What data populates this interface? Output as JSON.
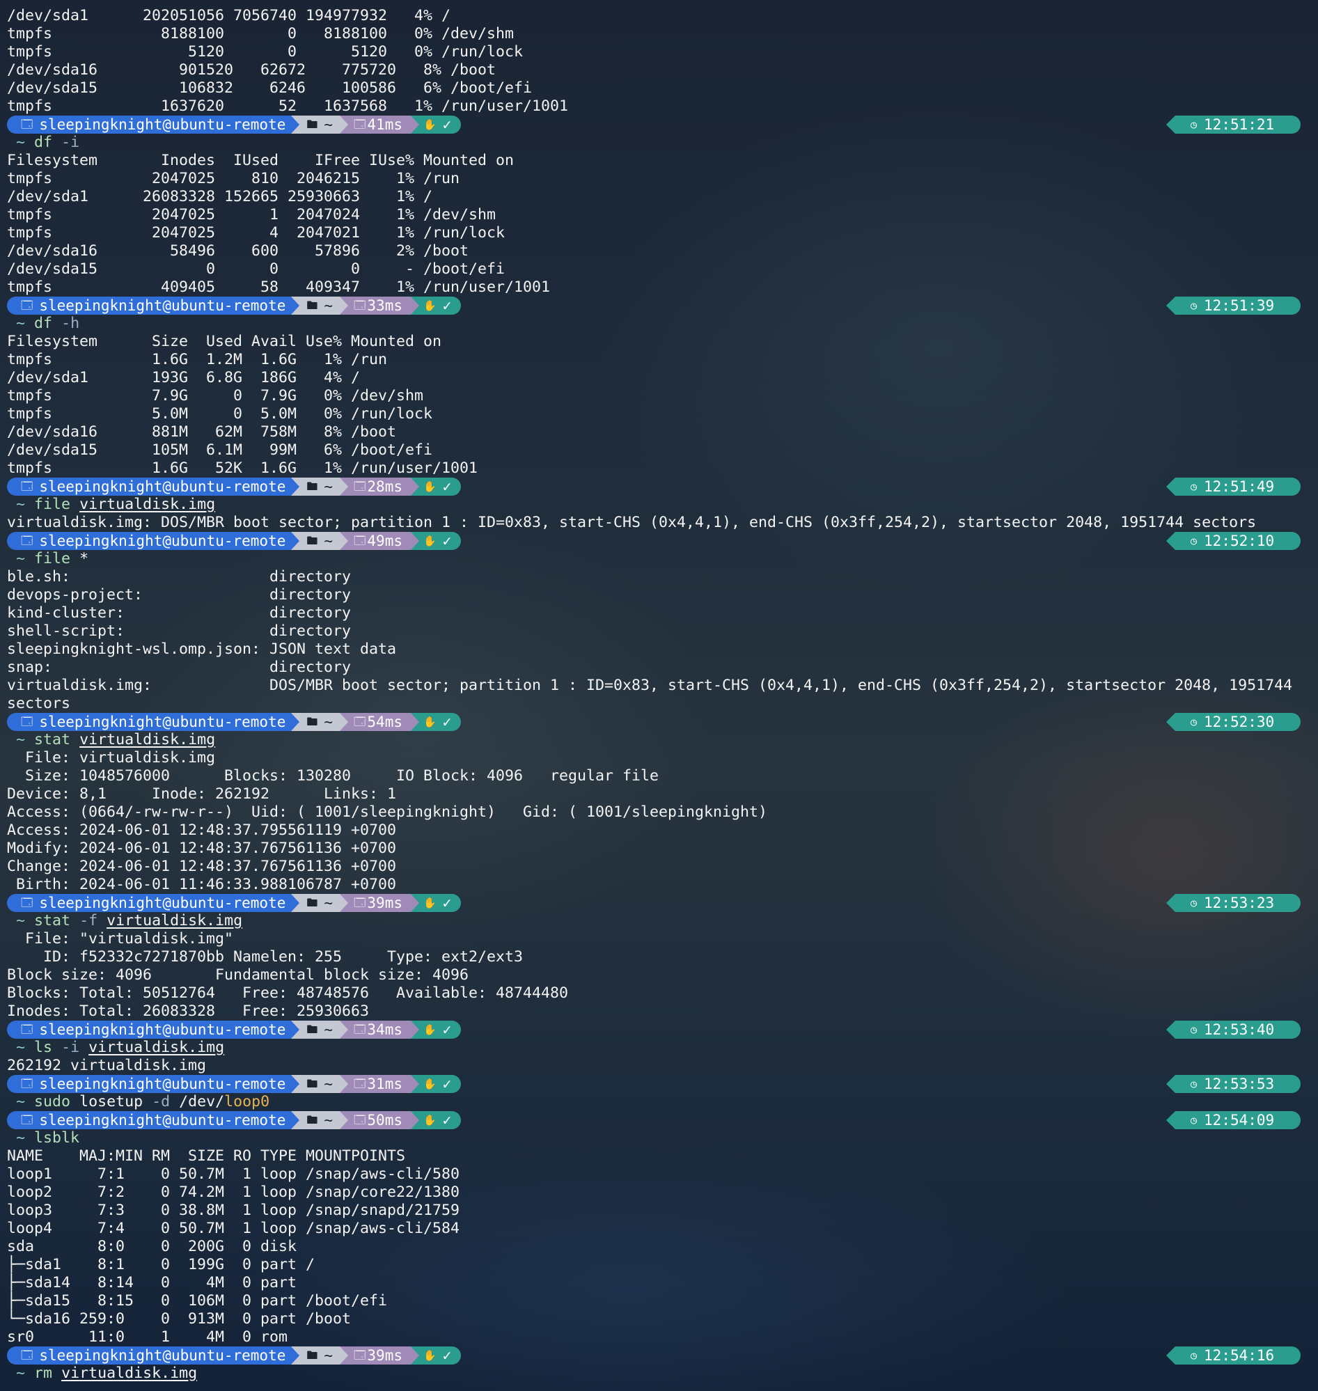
{
  "prompt": {
    "user_host": "sleepingknight@ubuntu-remote",
    "path_icon": "folder-icon",
    "path": "~",
    "status_icons": [
      "hand-icon",
      "check-icon"
    ],
    "check": "✓",
    "cwd_marker": "~",
    "clock_icon": "clock-icon"
  },
  "lines": [
    {
      "t": "out",
      "text": "/dev/sda1      202051056 7056740 194977932   4% /"
    },
    {
      "t": "out",
      "text": "tmpfs            8188100       0   8188100   0% /dev/shm"
    },
    {
      "t": "out",
      "text": "tmpfs               5120       0      5120   0% /run/lock"
    },
    {
      "t": "out",
      "text": "/dev/sda16         901520   62672    775720   8% /boot"
    },
    {
      "t": "out",
      "text": "/dev/sda15         106832    6246    100586   6% /boot/efi"
    },
    {
      "t": "out",
      "text": "tmpfs            1637620      52   1637568   1% /run/user/1001"
    },
    {
      "t": "prompt",
      "duration": "41ms",
      "clock": "12:51:21"
    },
    {
      "t": "cmd",
      "parts": [
        {
          "k": "name",
          "v": "df"
        },
        {
          "k": "sp",
          "v": " "
        },
        {
          "k": "flag",
          "v": "-i"
        }
      ]
    },
    {
      "t": "out",
      "text": "Filesystem       Inodes  IUsed    IFree IUse% Mounted on"
    },
    {
      "t": "out",
      "text": "tmpfs           2047025    810  2046215    1% /run"
    },
    {
      "t": "out",
      "text": "/dev/sda1      26083328 152665 25930663    1% /"
    },
    {
      "t": "out",
      "text": "tmpfs           2047025      1  2047024    1% /dev/shm"
    },
    {
      "t": "out",
      "text": "tmpfs           2047025      4  2047021    1% /run/lock"
    },
    {
      "t": "out",
      "text": "/dev/sda16        58496    600    57896    2% /boot"
    },
    {
      "t": "out",
      "text": "/dev/sda15            0      0        0     - /boot/efi"
    },
    {
      "t": "out",
      "text": "tmpfs            409405     58   409347    1% /run/user/1001"
    },
    {
      "t": "prompt",
      "duration": "33ms",
      "clock": "12:51:39"
    },
    {
      "t": "cmd",
      "parts": [
        {
          "k": "name",
          "v": "df"
        },
        {
          "k": "sp",
          "v": " "
        },
        {
          "k": "flag",
          "v": "-h"
        }
      ]
    },
    {
      "t": "out",
      "text": "Filesystem      Size  Used Avail Use% Mounted on"
    },
    {
      "t": "out",
      "text": "tmpfs           1.6G  1.2M  1.6G   1% /run"
    },
    {
      "t": "out",
      "text": "/dev/sda1       193G  6.8G  186G   4% /"
    },
    {
      "t": "out",
      "text": "tmpfs           7.9G     0  7.9G   0% /dev/shm"
    },
    {
      "t": "out",
      "text": "tmpfs           5.0M     0  5.0M   0% /run/lock"
    },
    {
      "t": "out",
      "text": "/dev/sda16      881M   62M  758M   8% /boot"
    },
    {
      "t": "out",
      "text": "/dev/sda15      105M  6.1M   99M   6% /boot/efi"
    },
    {
      "t": "out",
      "text": "tmpfs           1.6G   52K  1.6G   1% /run/user/1001"
    },
    {
      "t": "prompt",
      "duration": "28ms",
      "clock": "12:51:49"
    },
    {
      "t": "cmd",
      "parts": [
        {
          "k": "name",
          "v": "file"
        },
        {
          "k": "sp",
          "v": " "
        },
        {
          "k": "arg",
          "v": "virtualdisk.img"
        }
      ]
    },
    {
      "t": "out",
      "text": "virtualdisk.img: DOS/MBR boot sector; partition 1 : ID=0x83, start-CHS (0x4,4,1), end-CHS (0x3ff,254,2), startsector 2048, 1951744 sectors"
    },
    {
      "t": "prompt",
      "duration": "49ms",
      "clock": "12:52:10"
    },
    {
      "t": "cmd",
      "parts": [
        {
          "k": "name",
          "v": "file"
        },
        {
          "k": "sp",
          "v": " "
        },
        {
          "k": "plain",
          "v": "*"
        }
      ]
    },
    {
      "t": "out",
      "text": "ble.sh:                      directory"
    },
    {
      "t": "out",
      "text": "devops-project:              directory"
    },
    {
      "t": "out",
      "text": "kind-cluster:                directory"
    },
    {
      "t": "out",
      "text": "shell-script:                directory"
    },
    {
      "t": "out",
      "text": "sleepingknight-wsl.omp.json: JSON text data"
    },
    {
      "t": "out",
      "text": "snap:                        directory"
    },
    {
      "t": "out",
      "text": "virtualdisk.img:             DOS/MBR boot sector; partition 1 : ID=0x83, start-CHS (0x4,4,1), end-CHS (0x3ff,254,2), startsector 2048, 1951744"
    },
    {
      "t": "out",
      "text": "sectors"
    },
    {
      "t": "prompt",
      "duration": "54ms",
      "clock": "12:52:30"
    },
    {
      "t": "cmd",
      "parts": [
        {
          "k": "name",
          "v": "stat"
        },
        {
          "k": "sp",
          "v": " "
        },
        {
          "k": "arg",
          "v": "virtualdisk.img"
        }
      ]
    },
    {
      "t": "out",
      "text": "  File: virtualdisk.img"
    },
    {
      "t": "out",
      "text": "  Size: 1048576000      Blocks: 130280     IO Block: 4096   regular file"
    },
    {
      "t": "out",
      "text": "Device: 8,1     Inode: 262192      Links: 1"
    },
    {
      "t": "out",
      "text": "Access: (0664/-rw-rw-r--)  Uid: ( 1001/sleepingknight)   Gid: ( 1001/sleepingknight)"
    },
    {
      "t": "out",
      "text": "Access: 2024-06-01 12:48:37.795561119 +0700"
    },
    {
      "t": "out",
      "text": "Modify: 2024-06-01 12:48:37.767561136 +0700"
    },
    {
      "t": "out",
      "text": "Change: 2024-06-01 12:48:37.767561136 +0700"
    },
    {
      "t": "out",
      "text": " Birth: 2024-06-01 11:46:33.988106787 +0700"
    },
    {
      "t": "prompt",
      "duration": "39ms",
      "clock": "12:53:23"
    },
    {
      "t": "cmd",
      "parts": [
        {
          "k": "name",
          "v": "stat"
        },
        {
          "k": "sp",
          "v": " "
        },
        {
          "k": "flag",
          "v": "-f"
        },
        {
          "k": "sp",
          "v": " "
        },
        {
          "k": "arg",
          "v": "virtualdisk.img"
        }
      ]
    },
    {
      "t": "out",
      "text": "  File: \"virtualdisk.img\""
    },
    {
      "t": "out",
      "text": "    ID: f52332c7271870bb Namelen: 255     Type: ext2/ext3"
    },
    {
      "t": "out",
      "text": "Block size: 4096       Fundamental block size: 4096"
    },
    {
      "t": "out",
      "text": "Blocks: Total: 50512764   Free: 48748576   Available: 48744480"
    },
    {
      "t": "out",
      "text": "Inodes: Total: 26083328   Free: 25930663"
    },
    {
      "t": "prompt",
      "duration": "34ms",
      "clock": "12:53:40"
    },
    {
      "t": "cmd",
      "parts": [
        {
          "k": "name",
          "v": "ls"
        },
        {
          "k": "sp",
          "v": " "
        },
        {
          "k": "flag",
          "v": "-i"
        },
        {
          "k": "sp",
          "v": " "
        },
        {
          "k": "arg",
          "v": "virtualdisk.img"
        }
      ]
    },
    {
      "t": "out",
      "text": "262192 virtualdisk.img"
    },
    {
      "t": "prompt",
      "duration": "31ms",
      "clock": "12:53:53"
    },
    {
      "t": "cmd",
      "parts": [
        {
          "k": "name",
          "v": "sudo"
        },
        {
          "k": "sp",
          "v": " "
        },
        {
          "k": "plain",
          "v": "losetup"
        },
        {
          "k": "sp",
          "v": " "
        },
        {
          "k": "flag",
          "v": "-d"
        },
        {
          "k": "sp",
          "v": " "
        },
        {
          "k": "plain",
          "v": "/dev/"
        },
        {
          "k": "warn",
          "v": "loop0"
        }
      ]
    },
    {
      "t": "prompt",
      "duration": "50ms",
      "clock": "12:54:09"
    },
    {
      "t": "cmd",
      "parts": [
        {
          "k": "name",
          "v": "lsblk"
        }
      ]
    },
    {
      "t": "out",
      "text": "NAME    MAJ:MIN RM  SIZE RO TYPE MOUNTPOINTS"
    },
    {
      "t": "out",
      "text": "loop1     7:1    0 50.7M  1 loop /snap/aws-cli/580"
    },
    {
      "t": "out",
      "text": "loop2     7:2    0 74.2M  1 loop /snap/core22/1380"
    },
    {
      "t": "out",
      "text": "loop3     7:3    0 38.8M  1 loop /snap/snapd/21759"
    },
    {
      "t": "out",
      "text": "loop4     7:4    0 50.7M  1 loop /snap/aws-cli/584"
    },
    {
      "t": "out",
      "text": "sda       8:0    0  200G  0 disk"
    },
    {
      "t": "out",
      "text": "├─sda1    8:1    0  199G  0 part /"
    },
    {
      "t": "out",
      "text": "├─sda14   8:14   0    4M  0 part"
    },
    {
      "t": "out",
      "text": "├─sda15   8:15   0  106M  0 part /boot/efi"
    },
    {
      "t": "out",
      "text": "└─sda16 259:0    0  913M  0 part /boot"
    },
    {
      "t": "out",
      "text": "sr0      11:0    1    4M  0 rom"
    },
    {
      "t": "prompt",
      "duration": "39ms",
      "clock": "12:54:16"
    },
    {
      "t": "cmd",
      "parts": [
        {
          "k": "name",
          "v": "rm"
        },
        {
          "k": "sp",
          "v": " "
        },
        {
          "k": "arg",
          "v": "virtualdisk.img"
        }
      ]
    }
  ]
}
